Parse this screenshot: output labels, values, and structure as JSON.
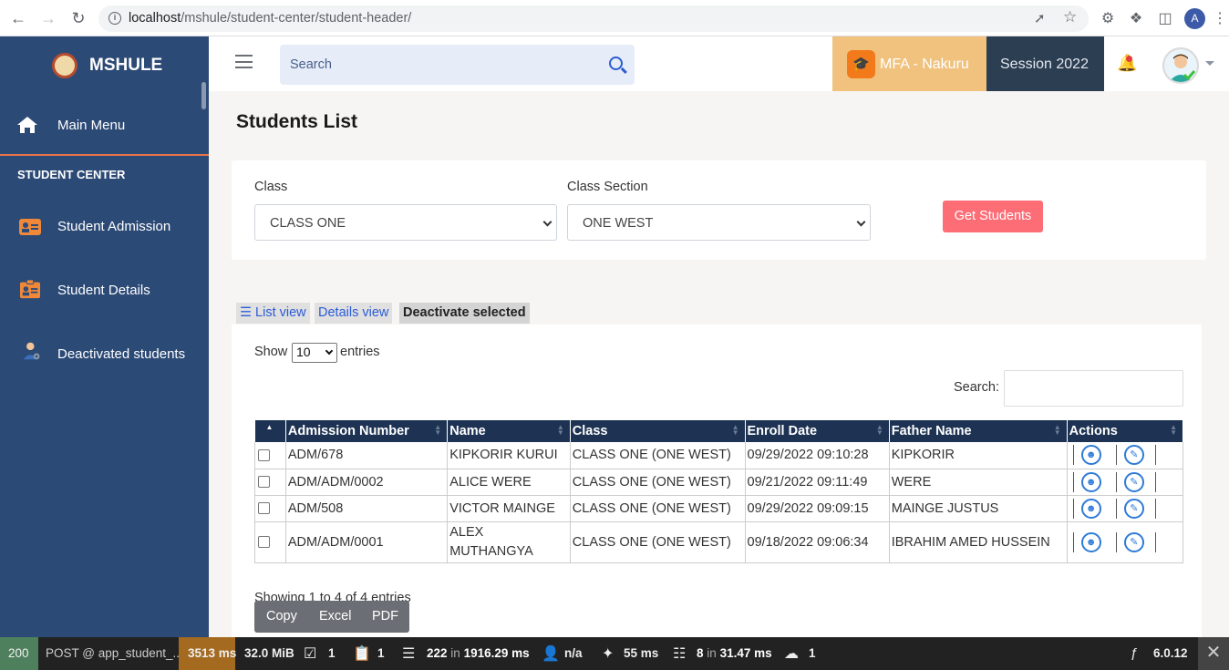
{
  "browser": {
    "url_host": "localhost",
    "url_path": "/mshule/student-center/student-header/",
    "profile_initial": "A"
  },
  "sidebar": {
    "brand": "MSHULE",
    "main_menu": "Main Menu",
    "section_title": "STUDENT CENTER",
    "items": [
      {
        "label": "Student Admission",
        "icon": "id-card-icon"
      },
      {
        "label": "Student Details",
        "icon": "clipboard-icon"
      },
      {
        "label": "Deactivated students",
        "icon": "user-gear-icon"
      }
    ]
  },
  "topbar": {
    "search_placeholder": "Search",
    "school": "MFA - Nakuru",
    "session": "Session 2022"
  },
  "page": {
    "title": "Students List",
    "filters": {
      "class_label": "Class",
      "class_value": "CLASS ONE",
      "section_label": "Class Section",
      "section_value": "ONE WEST",
      "get_button": "Get Students"
    },
    "tabs": {
      "list_view": "List view",
      "details_view": "Details view",
      "deactivate": "Deactivate selected"
    },
    "table_controls": {
      "show": "Show",
      "length": "10",
      "entries": "entries",
      "search": "Search:"
    },
    "columns": [
      "",
      "Admission Number",
      "Name",
      "Class",
      "Enroll Date",
      "Father Name",
      "Actions"
    ],
    "rows": [
      {
        "adm": "ADM/678",
        "name": "KIPKORIR KURUI",
        "cls": "CLASS ONE (ONE WEST)",
        "date": "09/29/2022 09:10:28",
        "father": "KIPKORIR"
      },
      {
        "adm": "ADM/ADM/0002",
        "name": "ALICE WERE",
        "cls": "CLASS ONE (ONE WEST)",
        "date": "09/21/2022 09:11:49",
        "father": "WERE"
      },
      {
        "adm": "ADM/508",
        "name": "VICTOR MAINGE",
        "cls": "CLASS ONE (ONE WEST)",
        "date": "09/29/2022 09:09:15",
        "father": "MAINGE JUSTUS"
      },
      {
        "adm": "ADM/ADM/0001",
        "name": "ALEX MUTHANGYA",
        "cls": "CLASS ONE (ONE WEST)",
        "date": "09/18/2022 09:06:34",
        "father": "IBRAHIM AMED HUSSEIN"
      }
    ],
    "info": "Showing 1 to 4 of 4 entries",
    "export": {
      "copy": "Copy",
      "excel": "Excel",
      "pdf": "PDF"
    }
  },
  "debug_bar": {
    "status": "200",
    "route": "POST @ app_student_...",
    "time": "3513 ms",
    "memory": "32.0 MiB",
    "forms": "1",
    "logs": "1",
    "cache": "222",
    "cache_time": "1916.29 ms",
    "user": "n/a",
    "events": "55 ms",
    "queries": "8",
    "queries_time": "31.47 ms",
    "http": "1",
    "version": "6.0.12"
  },
  "colors": {
    "sidebar": "#2c4a76",
    "accent": "#e8734a",
    "primary_btn": "#fc6d76",
    "table_header": "#1e3353"
  }
}
